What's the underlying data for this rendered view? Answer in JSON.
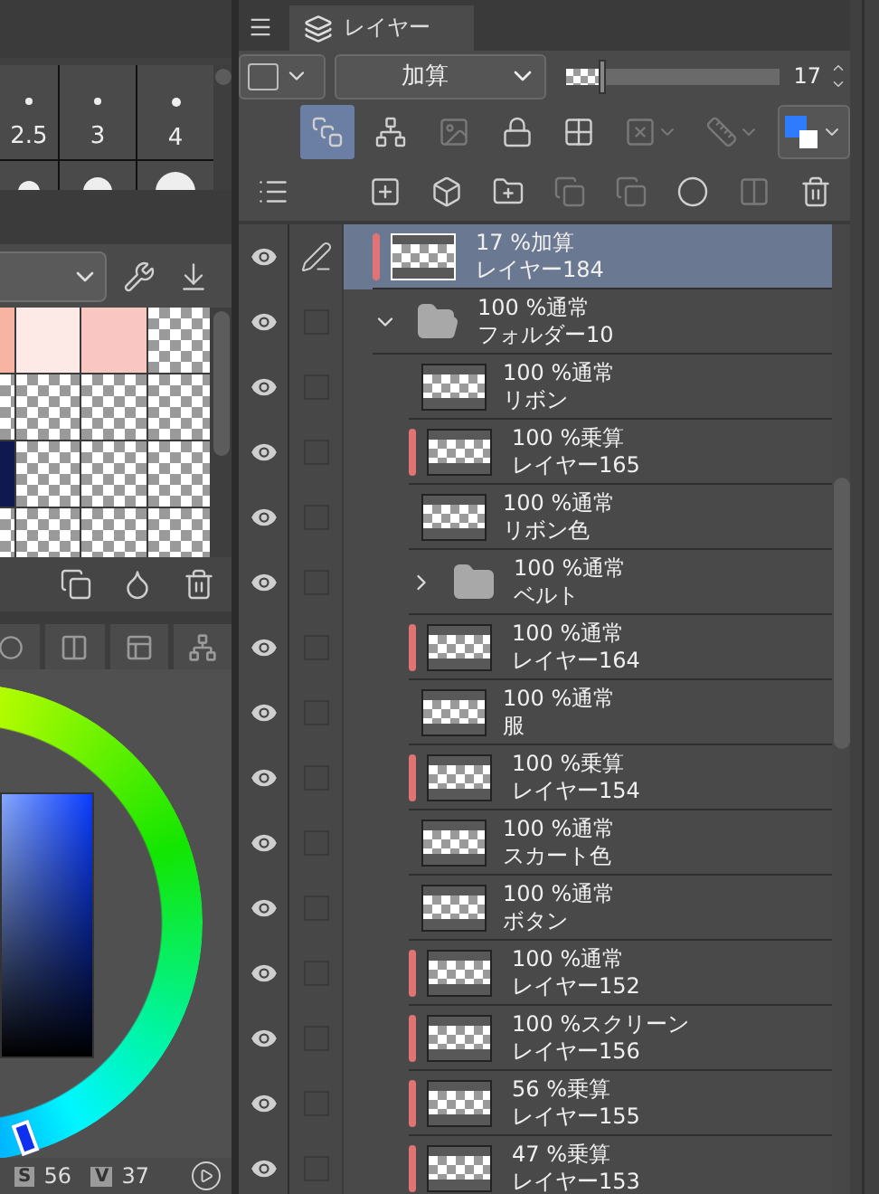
{
  "brush_sizes": [
    {
      "label": "2.5"
    },
    {
      "label": "3"
    },
    {
      "label": "4"
    }
  ],
  "color_set": {
    "swatches": [
      {
        "kind": "color",
        "color": "#f8b4a2"
      },
      {
        "kind": "color",
        "color": "#fdeae6"
      },
      {
        "kind": "color",
        "color": "#f9c6c2"
      },
      {
        "kind": "transparent"
      },
      {
        "kind": "transparent"
      },
      {
        "kind": "transparent"
      },
      {
        "kind": "transparent"
      },
      {
        "kind": "transparent"
      },
      {
        "kind": "color",
        "color": "#101850"
      },
      {
        "kind": "transparent"
      },
      {
        "kind": "transparent"
      },
      {
        "kind": "transparent"
      },
      {
        "kind": "transparent"
      },
      {
        "kind": "transparent"
      },
      {
        "kind": "transparent"
      },
      {
        "kind": "transparent"
      }
    ]
  },
  "color_values": [
    {
      "label": "S",
      "value": "56"
    },
    {
      "label": "V",
      "value": "37"
    }
  ],
  "layer_panel": {
    "tab": "レイヤー",
    "blend_mode": "加算",
    "opacity": {
      "level": 0.17,
      "value": "17"
    },
    "toolbar_1": [
      {
        "active": true,
        "disabled": false
      },
      {
        "active": false,
        "disabled": false
      },
      {
        "active": false,
        "disabled": true
      },
      {
        "active": false,
        "disabled": false
      },
      {
        "active": false,
        "disabled": false
      },
      {
        "active": false,
        "disabled": true
      },
      {
        "active": false,
        "disabled": true
      },
      {
        "active": false,
        "disabled": false
      }
    ],
    "toolbar_2": [
      {
        "disabled": false
      },
      {
        "disabled": false
      },
      {
        "disabled": false
      },
      {
        "disabled": false
      },
      {
        "disabled": true
      },
      {
        "disabled": true
      },
      {
        "disabled": false
      },
      {
        "disabled": true
      },
      {
        "disabled": false
      }
    ],
    "layers": [
      {
        "kind": "layer",
        "mode": "17 %加算",
        "name": "レイヤー184",
        "visible": true,
        "selected": true,
        "clipped": true
      },
      {
        "kind": "folder",
        "mode": "100 %通常",
        "name": "フォルダー10",
        "visible": true,
        "selected": false,
        "checked": false,
        "expanded": true,
        "children": [
          {
            "kind": "layer",
            "mode": "100 %通常",
            "name": "リボン",
            "visible": true,
            "selected": false,
            "checked": false,
            "clipped": false
          },
          {
            "kind": "layer",
            "mode": "100 %乗算",
            "name": "レイヤー165",
            "visible": true,
            "selected": false,
            "checked": false,
            "clipped": true
          },
          {
            "kind": "layer",
            "mode": "100 %通常",
            "name": "リボン色",
            "visible": true,
            "selected": false,
            "checked": false,
            "clipped": false
          },
          {
            "kind": "folder",
            "mode": "100 %通常",
            "name": "ベルト",
            "visible": true,
            "selected": false,
            "checked": false,
            "expanded": false
          },
          {
            "kind": "layer",
            "mode": "100 %通常",
            "name": "レイヤー164",
            "visible": true,
            "selected": false,
            "checked": false,
            "clipped": true
          },
          {
            "kind": "layer",
            "mode": "100 %通常",
            "name": "服",
            "visible": true,
            "selected": false,
            "checked": false,
            "clipped": false
          },
          {
            "kind": "layer",
            "mode": "100 %乗算",
            "name": "レイヤー154",
            "visible": true,
            "selected": false,
            "checked": false,
            "clipped": true
          },
          {
            "kind": "layer",
            "mode": "100 %通常",
            "name": "スカート色",
            "visible": true,
            "selected": false,
            "checked": false,
            "clipped": false
          },
          {
            "kind": "layer",
            "mode": "100 %通常",
            "name": "ボタン",
            "visible": true,
            "selected": false,
            "checked": false,
            "clipped": false
          },
          {
            "kind": "layer",
            "mode": "100 %通常",
            "name": "レイヤー152",
            "visible": true,
            "selected": false,
            "checked": false,
            "clipped": true
          },
          {
            "kind": "layer",
            "mode": "100 %スクリーン",
            "name": "レイヤー156",
            "visible": true,
            "selected": false,
            "checked": false,
            "clipped": true
          },
          {
            "kind": "layer",
            "mode": "56 %乗算",
            "name": "レイヤー155",
            "visible": true,
            "selected": false,
            "checked": false,
            "clipped": true
          },
          {
            "kind": "layer",
            "mode": "47 %乗算",
            "name": "レイヤー153",
            "visible": true,
            "selected": false,
            "checked": false,
            "clipped": true
          }
        ]
      }
    ]
  }
}
